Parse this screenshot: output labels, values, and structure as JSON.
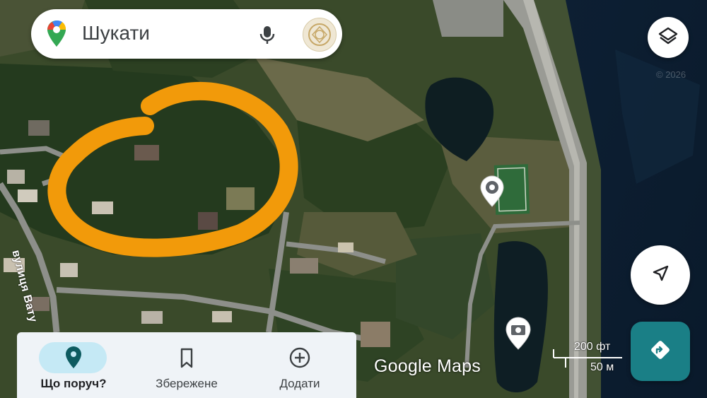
{
  "search": {
    "placeholder": "Шукати"
  },
  "map": {
    "street_label": "вулиця Вату",
    "watermark": "Google Maps",
    "copyright": "© 2026",
    "scale": {
      "imperial": "200 фт",
      "metric": "50 м"
    },
    "icons": [
      "layers-icon",
      "location-pin-icon",
      "photo-pin-icon",
      "my-location-icon",
      "directions-icon"
    ]
  },
  "nav": {
    "items": [
      {
        "label": "Що поруч?",
        "icon": "location-pin-icon",
        "active": true
      },
      {
        "label": "Збережене",
        "icon": "bookmark-icon",
        "active": false
      },
      {
        "label": "Додати",
        "icon": "add-circle-icon",
        "active": false
      }
    ]
  },
  "colors": {
    "annotation": "#f29a0a",
    "directions_button": "#1a7f86",
    "nav_active_pill": "#c5e9f5",
    "nav_background": "#eff3f7"
  }
}
